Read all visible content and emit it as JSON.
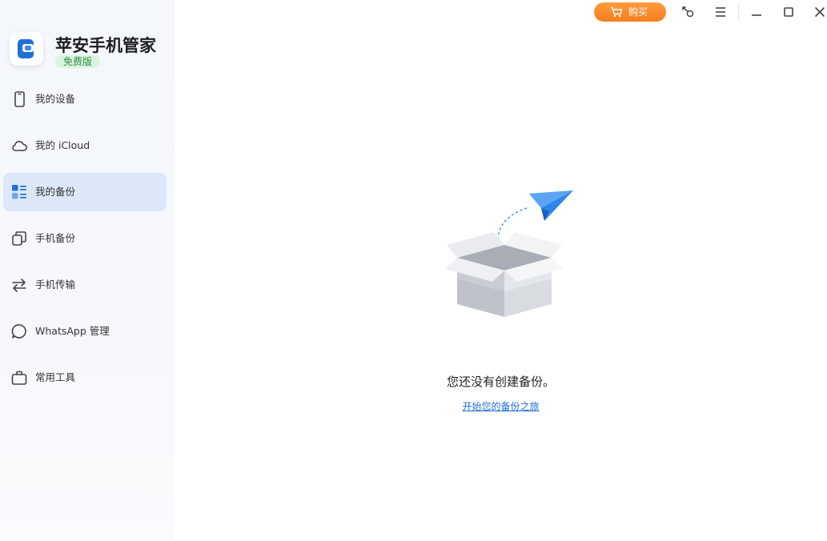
{
  "app": {
    "name": "苹安手机管家",
    "badge": "免费版"
  },
  "sidebar": {
    "items": [
      {
        "label": "我的设备",
        "icon": "phone-icon",
        "active": false
      },
      {
        "label": "我的 iCloud",
        "icon": "cloud-icon",
        "active": false
      },
      {
        "label": "我的备份",
        "icon": "backup-icon",
        "active": true
      },
      {
        "label": "手机备份",
        "icon": "copy-icon",
        "active": false
      },
      {
        "label": "手机传输",
        "icon": "transfer-icon",
        "active": false
      },
      {
        "label": "WhatsApp 管理",
        "icon": "chat-bubble-icon",
        "active": false
      },
      {
        "label": "常用工具",
        "icon": "toolbox-icon",
        "active": false
      }
    ]
  },
  "titlebar": {
    "buy_label": "购买",
    "icons": [
      "cart-icon",
      "key-icon",
      "menu-icon",
      "minimize-icon",
      "maximize-icon",
      "close-icon"
    ]
  },
  "empty_state": {
    "title": "您还没有创建备份。",
    "link": "开始您的备份之旅",
    "illustration": "open-box-with-paper-plane"
  },
  "colors": {
    "accent": "#1f6fd6",
    "active_bg": "#dce8fa",
    "buy_orange": "#f8892a",
    "badge_green": "#2a8f3c",
    "badge_bg": "#dbf3df"
  }
}
